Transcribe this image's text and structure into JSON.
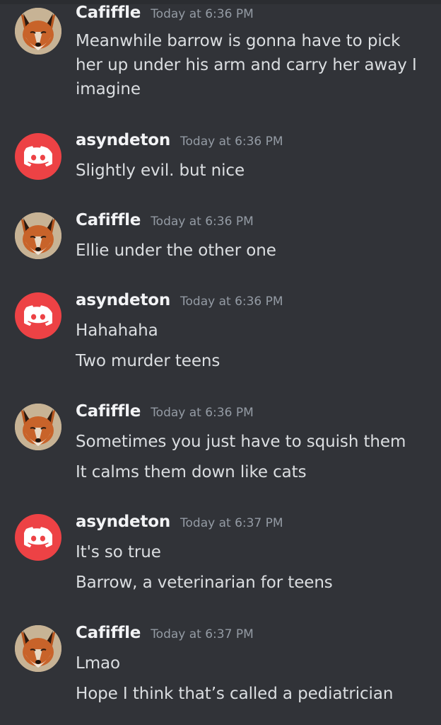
{
  "messages": [
    {
      "author": "Cafiffle",
      "avatar": "fox-avatar",
      "time": "Today at 6:36 PM",
      "lines": [
        "Meanwhile barrow is gonna have to pick her up under his arm and carry her away I imagine"
      ]
    },
    {
      "author": "asyndeton",
      "avatar": "discord-default-avatar",
      "time": "Today at 6:36 PM",
      "lines": [
        "Slightly evil. but nice"
      ]
    },
    {
      "author": "Cafiffle",
      "avatar": "fox-avatar",
      "time": "Today at 6:36 PM",
      "lines": [
        "Ellie under the other one"
      ]
    },
    {
      "author": "asyndeton",
      "avatar": "discord-default-avatar",
      "time": "Today at 6:36 PM",
      "lines": [
        "Hahahaha",
        "Two murder teens"
      ]
    },
    {
      "author": "Cafiffle",
      "avatar": "fox-avatar",
      "time": "Today at 6:36 PM",
      "lines": [
        "Sometimes you just have to squish them",
        "It calms them down like cats"
      ]
    },
    {
      "author": "asyndeton",
      "avatar": "discord-default-avatar",
      "time": "Today at 6:37 PM",
      "lines": [
        "It's so true",
        "Barrow, a veterinarian for teens"
      ]
    },
    {
      "author": "Cafiffle",
      "avatar": "fox-avatar",
      "time": "Today at 6:37 PM",
      "lines": [
        "Lmao",
        "Hope I think that’s called a pediatrician"
      ]
    }
  ],
  "colors": {
    "background": "#313338",
    "discord_avatar": "#ed4245",
    "username": "#f2f3f5",
    "timestamp": "#949ba4",
    "message_text": "#dbdee1"
  }
}
